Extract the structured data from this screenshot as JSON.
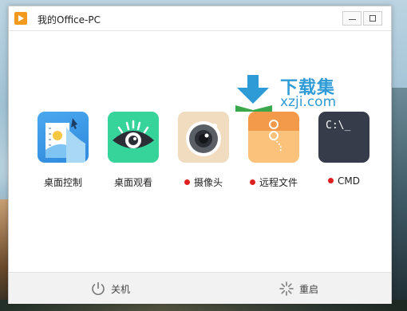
{
  "window": {
    "title": "我的Office-PC"
  },
  "watermark": {
    "title": "下载集",
    "url": "xzji.com"
  },
  "apps": [
    {
      "label": "桌面控制",
      "status_dot": false,
      "icon": "desktop-control-icon"
    },
    {
      "label": "桌面观看",
      "status_dot": false,
      "icon": "eye-icon"
    },
    {
      "label": "摄像头",
      "status_dot": true,
      "icon": "camera-icon"
    },
    {
      "label": "远程文件",
      "status_dot": true,
      "icon": "folder-icon"
    },
    {
      "label": "CMD",
      "status_dot": true,
      "icon": "cmd-icon"
    }
  ],
  "cmd_prompt": "C:\\_",
  "bottom": {
    "shutdown_label": "关机",
    "restart_label": "重启"
  },
  "colors": {
    "status_dot": "#e02020",
    "watermark": "#2e9bd6",
    "app_icon": "#f39a1e"
  }
}
